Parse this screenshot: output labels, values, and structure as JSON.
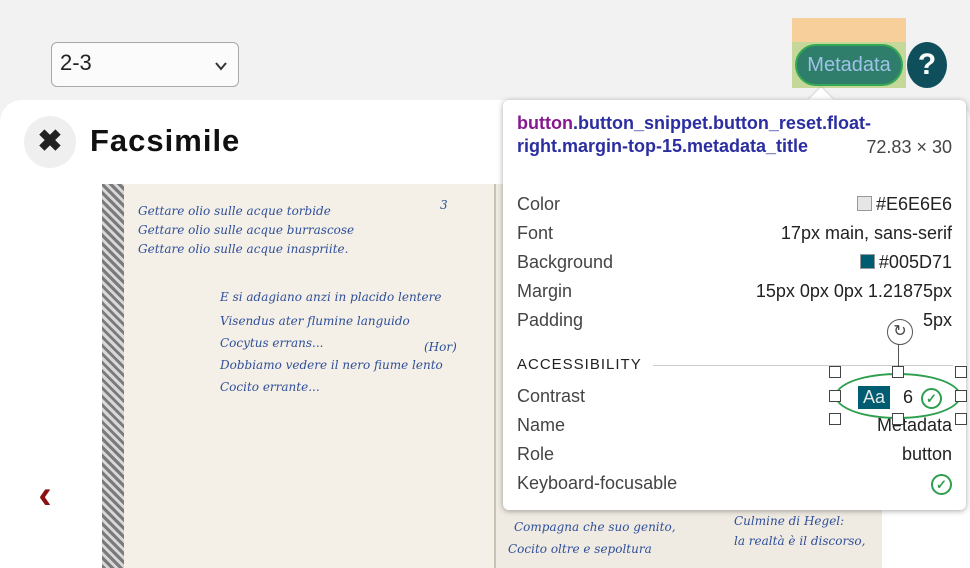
{
  "page_select": {
    "value": "2-3"
  },
  "header": {
    "metadata_label": "Metadata",
    "help_label": "?"
  },
  "viewer": {
    "title": "Facsimile",
    "close_label": "✖",
    "prev_label": "‹"
  },
  "manuscript": {
    "page_number": "3",
    "lines": [
      "Gettare olio sulle acque torbide",
      "Gettare olio sulle acque burrascose",
      "Gettare olio sulle acque inaspriite.",
      "E si adagiano anzi in placido lentere",
      "Visendus ater flumine languido",
      "Cocytus errans...",
      "(Hor)",
      "Dobbiamo vedere il nero fiume lento",
      "Cocito errante...",
      "Compagna che suo genito,",
      "Cocito oltre e sepoltura",
      "Culmine di Hegel:",
      "la realtà è il discorso,"
    ]
  },
  "inspector": {
    "selector_tag": "button",
    "selector_classes": ".button_snippet.button_reset.float-right.margin-top-15.metadata_title",
    "dimensions": "72.83 × 30",
    "rows": [
      {
        "key": "Color",
        "value": "#E6E6E6",
        "swatch": "#E6E6E6"
      },
      {
        "key": "Font",
        "value": "17px main, sans-serif"
      },
      {
        "key": "Background",
        "value": "#005D71",
        "swatch": "#005D71"
      },
      {
        "key": "Margin",
        "value": "15px 0px 0px 1.21875px"
      },
      {
        "key": "Padding",
        "value": "5px"
      }
    ],
    "accessibility_heading": "ACCESSIBILITY",
    "contrast_label": "Contrast",
    "contrast_sample": "Aa",
    "contrast_value": "6",
    "name_label": "Name",
    "name_value": "Metadata",
    "role_label": "Role",
    "role_value": "button",
    "focusable_label": "Keyboard-focusable"
  }
}
